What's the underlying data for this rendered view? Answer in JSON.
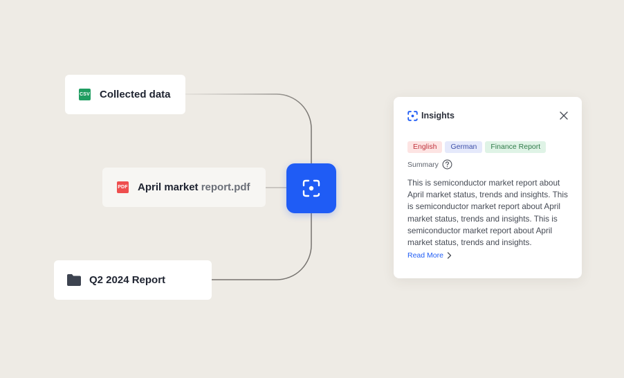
{
  "sources": {
    "csv": {
      "badge": "CSV",
      "label": "Collected data"
    },
    "pdf": {
      "badge": "PDF",
      "label_main": "April market ",
      "label_fade": "report.pdf"
    },
    "folder": {
      "label": "Q2 2024 Report",
      "icon": "folder-icon"
    }
  },
  "hub": {
    "icon": "scan-insight-icon",
    "color": "#1f5cf5"
  },
  "insights_panel": {
    "title": "Insights",
    "logo_icon": "insight-logo-icon",
    "close_icon": "close-icon",
    "tags": [
      {
        "label": "English",
        "color": "#c0343d"
      },
      {
        "label": "German",
        "color": "#3d4fa8"
      },
      {
        "label": "Finance Report",
        "color": "#2f7a49"
      }
    ],
    "summary_label": "Summary",
    "summary_help_icon": "help-circle-icon",
    "summary_text": "This is semiconductor market report about April market status, trends and insights. This is semiconductor market report about April market status, trends and insights. This is semiconductor market report about April market status, trends and insights.",
    "read_more_label": "Read More",
    "read_more_icon": "chevron-right-icon"
  },
  "colors": {
    "background": "#eeebe5",
    "accent": "#1f5cf5"
  }
}
